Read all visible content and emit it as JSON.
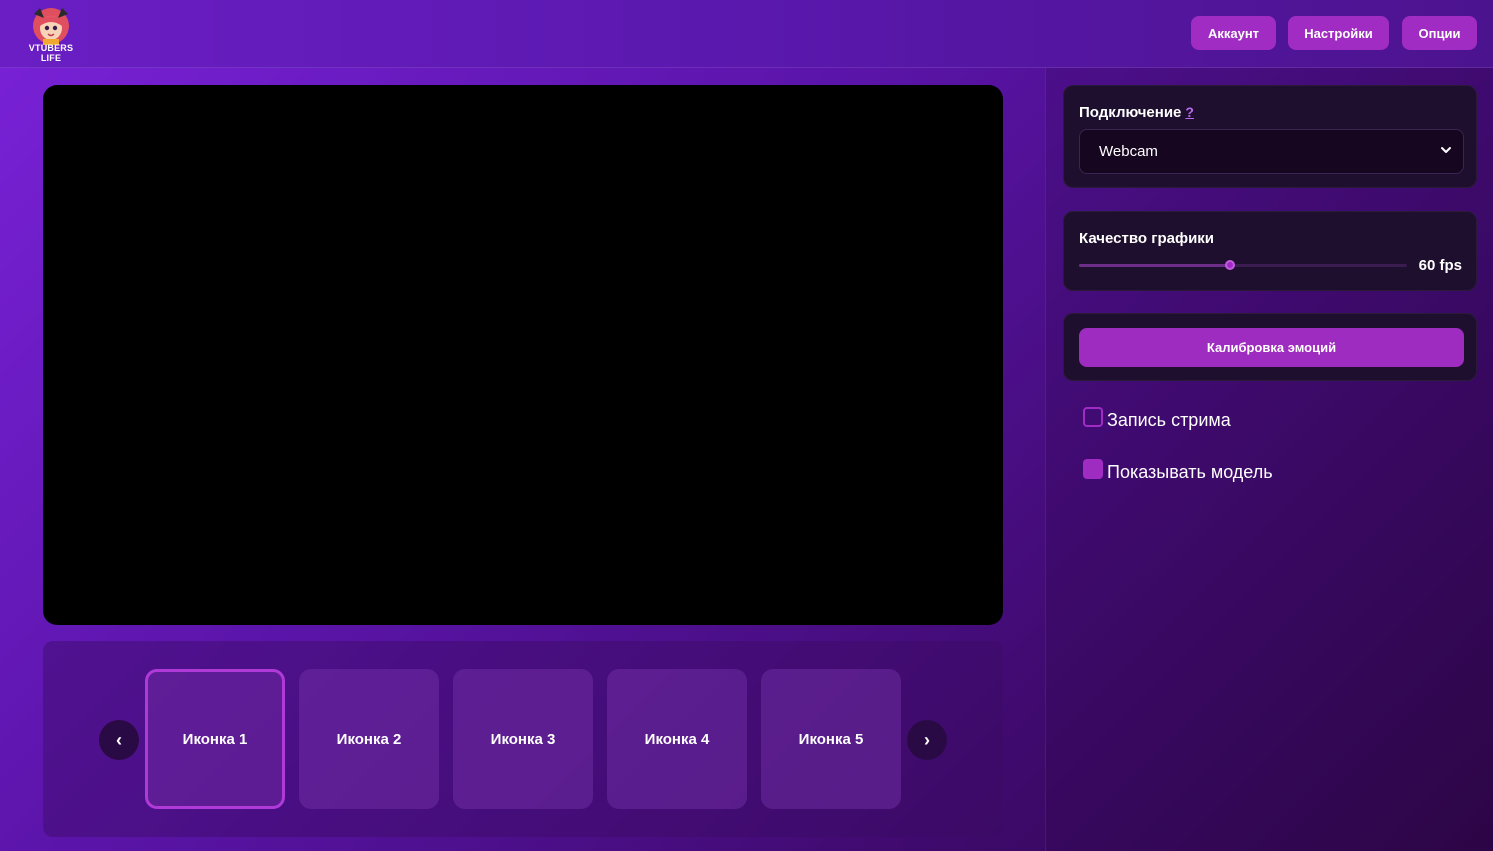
{
  "header": {
    "logo_text_line1": "VTUBERS",
    "logo_text_line2": "LIFE",
    "buttons": [
      {
        "label": "Аккаунт"
      },
      {
        "label": "Настройки"
      },
      {
        "label": "Опции"
      }
    ]
  },
  "carousel": {
    "prev_label": "‹",
    "next_label": "›",
    "items": [
      {
        "label": "Иконка 1",
        "active": true
      },
      {
        "label": "Иконка 2",
        "active": false
      },
      {
        "label": "Иконка 3",
        "active": false
      },
      {
        "label": "Иконка 4",
        "active": false
      },
      {
        "label": "Иконка 5",
        "active": false
      }
    ]
  },
  "connection": {
    "title": "Подключение",
    "help": "?",
    "selected": "Webcam"
  },
  "graphics": {
    "title": "Качество графики",
    "value_label": "60 fps",
    "slider_fraction": 0.46
  },
  "calibration": {
    "button_label": "Калибровка эмоций"
  },
  "options": {
    "record_stream": {
      "label": "Запись стрима",
      "checked": false
    },
    "show_model": {
      "label": "Показывать модель",
      "checked": true
    }
  },
  "colors": {
    "accent": "#a02cc4",
    "background_start": "#7a22d9",
    "background_end": "#2e0648",
    "card_bg": "#1f0f2e"
  }
}
